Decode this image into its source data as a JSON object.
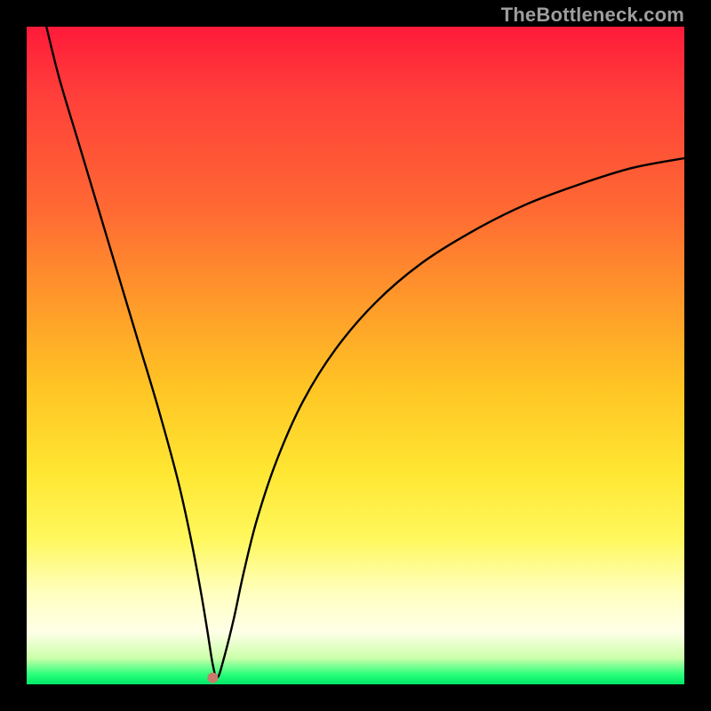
{
  "watermark": "TheBottleneck.com",
  "colors": {
    "curve_stroke": "#000000",
    "dot_fill": "#c97a6c",
    "frame_bg": "#000000"
  },
  "chart_data": {
    "type": "line",
    "title": "",
    "xlabel": "",
    "ylabel": "",
    "xlim": [
      0,
      100
    ],
    "ylim": [
      0,
      100
    ],
    "grid": false,
    "legend": false,
    "description": "V-shaped bottleneck curve descending steeply from upper-left, reaching a minimum near x≈28, then rising with a decelerating (concave-down) curve toward the right, ending near x=100, y≈80. Background is a red→orange→yellow→green vertical gradient (green at bottom).",
    "series": [
      {
        "name": "bottleneck-curve",
        "x": [
          3,
          5,
          8,
          11,
          14,
          17,
          20,
          23,
          25,
          26.5,
          27.5,
          28.3,
          29,
          30,
          31.5,
          33,
          35,
          38,
          42,
          47,
          53,
          60,
          68,
          76,
          84,
          92,
          100
        ],
        "y": [
          100,
          92,
          82,
          72,
          62,
          52,
          42,
          31,
          22,
          14,
          8,
          3,
          1,
          4,
          10,
          17,
          25,
          34,
          43,
          51,
          58,
          64,
          69,
          73,
          76,
          78.5,
          80
        ]
      }
    ],
    "marker": {
      "x": 28.3,
      "y": 1,
      "color": "#c97a6c"
    }
  }
}
